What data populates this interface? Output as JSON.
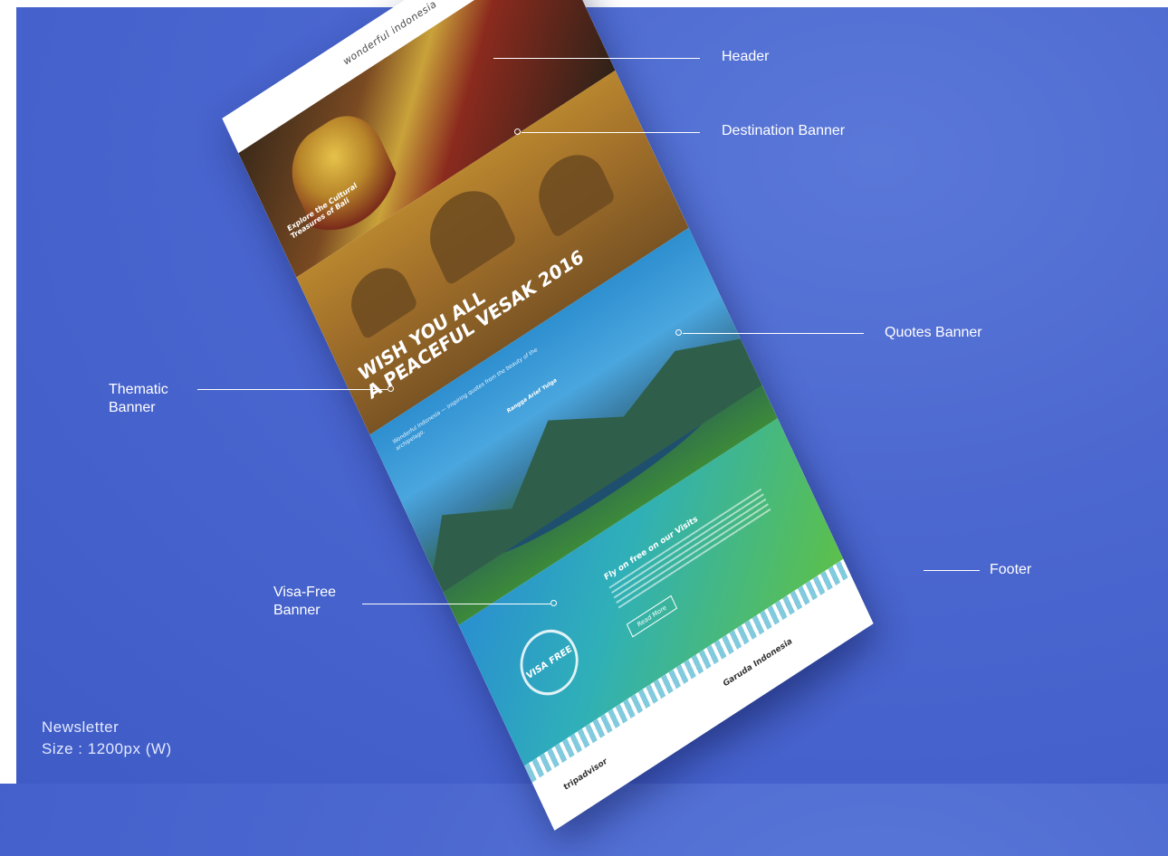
{
  "mockup": {
    "header_logo": "wonderful indonesia",
    "destination_title": "Explore the Cultural Treasures of Bali",
    "thematic_title_line1": "WISH YOU ALL",
    "thematic_title_line2": "A PEACEFUL VESAK 2016",
    "quote_text": "Wonderful Indonesia — inspiring quotes from the beauty of the archipelago.",
    "quote_author": "Rangga Arief Yulga",
    "visa_stamp": "VISA FREE",
    "visa_heading": "Fly on free on our Visits",
    "visa_button": "Read More",
    "footer_tripadvisor": "tripadvisor",
    "footer_partner": "Garuda Indonesia"
  },
  "annotations": {
    "header": "Header",
    "destination_banner": "Destination Banner",
    "quotes_banner": "Quotes Banner",
    "thematic_banner_line1": "Thematic",
    "thematic_banner_line2": "Banner",
    "footer": "Footer",
    "visa_banner_line1": "Visa-Free",
    "visa_banner_line2": "Banner"
  },
  "caption": {
    "line1": "Newsletter",
    "line2": "Size : 1200px (W)"
  }
}
